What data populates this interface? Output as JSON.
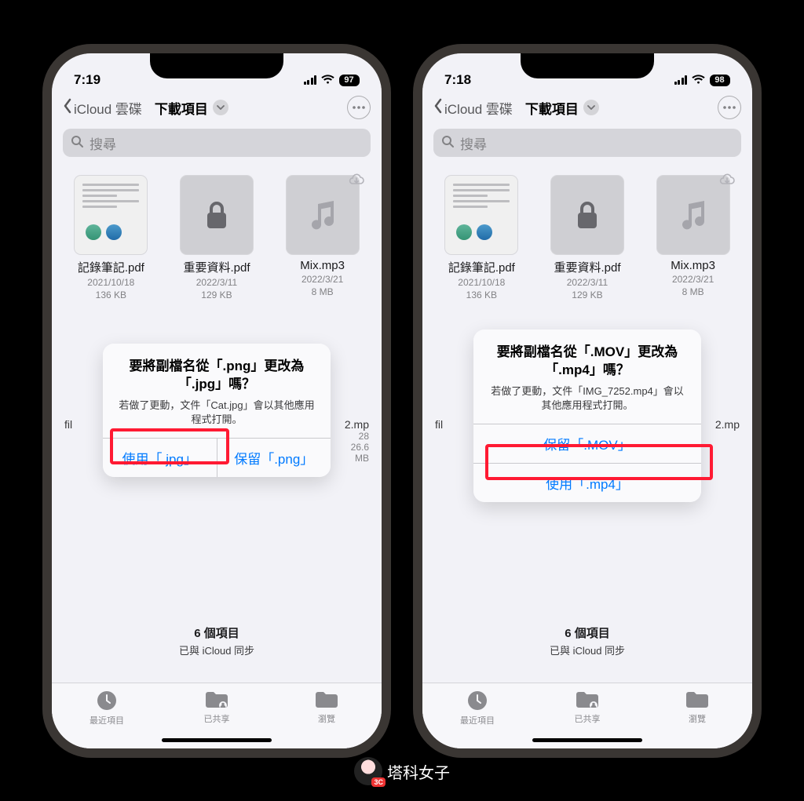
{
  "watermark": "塔科女子",
  "watermark_badge": "3C",
  "phones": [
    {
      "status": {
        "time": "7:19",
        "battery": "97"
      },
      "nav": {
        "back": "iCloud 雲碟",
        "title": "下載項目"
      },
      "search_placeholder": "搜尋",
      "files": [
        {
          "name": "記錄筆記.pdf",
          "date": "2021/10/18",
          "size": "136 KB",
          "icon": "doc"
        },
        {
          "name": "重要資料.pdf",
          "date": "2022/3/11",
          "size": "129 KB",
          "icon": "lock"
        },
        {
          "name": "Mix.mp3",
          "date": "2022/3/21",
          "size": "8 MB",
          "icon": "music",
          "cloud": true
        }
      ],
      "hidden_left": "fil",
      "hidden_right_top": "2.mp",
      "hidden_right_date": "28",
      "hidden_right_size": "26.6 MB",
      "footer": {
        "count": "6 個項目",
        "sync": "已與 iCloud 同步"
      },
      "tabs": [
        "最近項目",
        "已共享",
        "瀏覽"
      ],
      "alert": {
        "title": "要將副檔名從「.png」更改為「.jpg」嗎？",
        "message": "若做了更動，文件「Cat.jpg」會以其他應用程式打開。",
        "layout": "row",
        "buttons": [
          "使用「.jpg」",
          "保留「.png」"
        ],
        "highlight_index": 0
      }
    },
    {
      "status": {
        "time": "7:18",
        "battery": "98"
      },
      "nav": {
        "back": "iCloud 雲碟",
        "title": "下載項目"
      },
      "search_placeholder": "搜尋",
      "files": [
        {
          "name": "記錄筆記.pdf",
          "date": "2021/10/18",
          "size": "136 KB",
          "icon": "doc"
        },
        {
          "name": "重要資料.pdf",
          "date": "2022/3/11",
          "size": "129 KB",
          "icon": "lock"
        },
        {
          "name": "Mix.mp3",
          "date": "2022/3/21",
          "size": "8 MB",
          "icon": "music",
          "cloud": true
        }
      ],
      "hidden_left": "fil",
      "hidden_right_top": "2.mp",
      "footer": {
        "count": "6 個項目",
        "sync": "已與 iCloud 同步"
      },
      "tabs": [
        "最近項目",
        "已共享",
        "瀏覽"
      ],
      "alert": {
        "title": "要將副檔名從「.MOV」更改為「.mp4」嗎？",
        "message": "若做了更動，文件「IMG_7252.mp4」會以其他應用程式打開。",
        "layout": "stack",
        "buttons": [
          "保留「.MOV」",
          "使用「.mp4」"
        ],
        "highlight_index": 1
      }
    }
  ]
}
